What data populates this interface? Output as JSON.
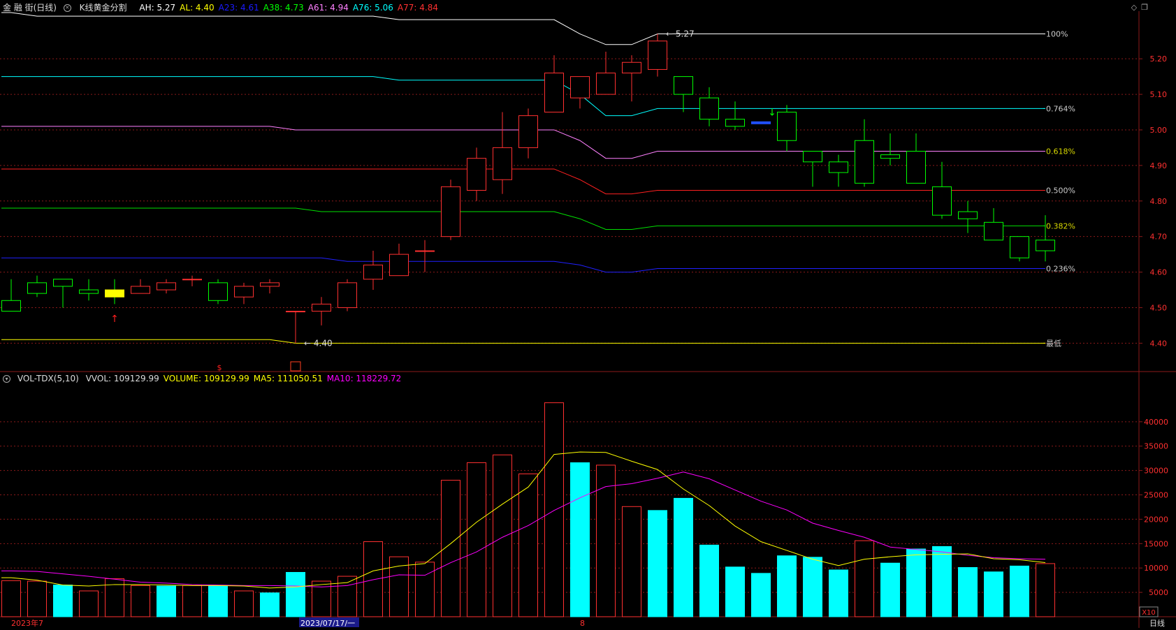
{
  "header": {
    "stock": "金 融 街(日线)",
    "indicator_name": "K线黄金分割",
    "values": [
      {
        "label": "AH: 5.27",
        "color": "#ffffff"
      },
      {
        "label": "AL: 4.40",
        "color": "#ffff00"
      },
      {
        "label": "A23: 4.61",
        "color": "#1a1aff"
      },
      {
        "label": "A38: 4.73",
        "color": "#00ff00"
      },
      {
        "label": "A61: 4.94",
        "color": "#ff80ff"
      },
      {
        "label": "A76: 5.06",
        "color": "#00ffff"
      },
      {
        "label": "A77: 4.84",
        "color": "#ff3030"
      }
    ]
  },
  "vol_header": {
    "name": "VOL-TDX(5,10)",
    "items": [
      {
        "label": "VVOL: 109129.99",
        "color": "#dddddd"
      },
      {
        "label": "VOLUME: 109129.99",
        "color": "#ffff00"
      },
      {
        "label": "MA5: 111050.51",
        "color": "#ffff00"
      },
      {
        "label": "MA10: 118229.72",
        "color": "#ff00ff"
      }
    ]
  },
  "footer": {
    "date_left": "2023年7",
    "date_cursor": "2023/07/17/一",
    "date_mid": "8",
    "period_tab": "日线",
    "scale_tag": "X10"
  },
  "colors": {
    "up": "#ff3030",
    "down": "#00ff00",
    "cyan_bar": "#00ffff",
    "ma5": "#ffff00",
    "ma10": "#ff00ff",
    "grid": "#8b1a1a"
  },
  "chart_data": [
    {
      "type": "candlestick",
      "ylim": [
        4.33,
        5.33
      ],
      "y_ticks": [
        "5.20",
        "5.10",
        "5.00",
        "4.90",
        "4.80",
        "4.70",
        "4.60",
        "4.50",
        "4.40"
      ],
      "candles": [
        {
          "o": 4.52,
          "h": 4.58,
          "l": 4.49,
          "c": 4.49
        },
        {
          "o": 4.57,
          "h": 4.59,
          "l": 4.53,
          "c": 4.54
        },
        {
          "o": 4.58,
          "h": 4.58,
          "l": 4.5,
          "c": 4.56
        },
        {
          "o": 4.55,
          "h": 4.58,
          "l": 4.52,
          "c": 4.54
        },
        {
          "o": 4.55,
          "h": 4.58,
          "l": 4.51,
          "c": 4.53
        },
        {
          "o": 4.54,
          "h": 4.58,
          "l": 4.54,
          "c": 4.56
        },
        {
          "o": 4.55,
          "h": 4.58,
          "l": 4.54,
          "c": 4.57
        },
        {
          "o": 4.58,
          "h": 4.59,
          "l": 4.56,
          "c": 4.58
        },
        {
          "o": 4.57,
          "h": 4.58,
          "l": 4.51,
          "c": 4.52
        },
        {
          "o": 4.53,
          "h": 4.57,
          "l": 4.51,
          "c": 4.56
        },
        {
          "o": 4.56,
          "h": 4.58,
          "l": 4.54,
          "c": 4.57
        },
        {
          "o": 4.49,
          "h": 4.49,
          "l": 4.4,
          "c": 4.49
        },
        {
          "o": 4.49,
          "h": 4.53,
          "l": 4.45,
          "c": 4.51
        },
        {
          "o": 4.5,
          "h": 4.58,
          "l": 4.49,
          "c": 4.57
        },
        {
          "o": 4.58,
          "h": 4.66,
          "l": 4.55,
          "c": 4.62
        },
        {
          "o": 4.59,
          "h": 4.68,
          "l": 4.59,
          "c": 4.65
        },
        {
          "o": 4.66,
          "h": 4.69,
          "l": 4.6,
          "c": 4.66
        },
        {
          "o": 4.7,
          "h": 4.86,
          "l": 4.69,
          "c": 4.84
        },
        {
          "o": 4.83,
          "h": 4.95,
          "l": 4.8,
          "c": 4.92
        },
        {
          "o": 4.86,
          "h": 5.05,
          "l": 4.82,
          "c": 4.95
        },
        {
          "o": 4.95,
          "h": 5.06,
          "l": 4.92,
          "c": 5.04
        },
        {
          "o": 5.05,
          "h": 5.21,
          "l": 5.05,
          "c": 5.16
        },
        {
          "o": 5.09,
          "h": 5.15,
          "l": 5.06,
          "c": 5.15
        },
        {
          "o": 5.1,
          "h": 5.22,
          "l": 5.1,
          "c": 5.16
        },
        {
          "o": 5.16,
          "h": 5.21,
          "l": 5.08,
          "c": 5.19
        },
        {
          "o": 5.17,
          "h": 5.27,
          "l": 5.15,
          "c": 5.25
        },
        {
          "o": 5.15,
          "h": 5.15,
          "l": 5.05,
          "c": 5.1
        },
        {
          "o": 5.09,
          "h": 5.12,
          "l": 5.01,
          "c": 5.03
        },
        {
          "o": 5.03,
          "h": 5.08,
          "l": 5.0,
          "c": 5.01
        },
        {
          "o": 5.02,
          "h": 5.02,
          "l": 5.02,
          "c": 5.02,
          "flat": true
        },
        {
          "o": 5.05,
          "h": 5.07,
          "l": 4.94,
          "c": 4.97
        },
        {
          "o": 4.94,
          "h": 4.94,
          "l": 4.84,
          "c": 4.91
        },
        {
          "o": 4.91,
          "h": 4.93,
          "l": 4.84,
          "c": 4.88
        },
        {
          "o": 4.97,
          "h": 5.03,
          "l": 4.84,
          "c": 4.85
        },
        {
          "o": 4.93,
          "h": 4.99,
          "l": 4.9,
          "c": 4.92
        },
        {
          "o": 4.94,
          "h": 4.99,
          "l": 4.85,
          "c": 4.85
        },
        {
          "o": 4.84,
          "h": 4.91,
          "l": 4.75,
          "c": 4.76
        },
        {
          "o": 4.77,
          "h": 4.8,
          "l": 4.71,
          "c": 4.75
        },
        {
          "o": 4.74,
          "h": 4.78,
          "l": 4.69,
          "c": 4.69
        },
        {
          "o": 4.7,
          "h": 4.7,
          "l": 4.63,
          "c": 4.64
        },
        {
          "o": 4.69,
          "h": 4.76,
          "l": 4.63,
          "c": 4.66
        }
      ],
      "fib_levels": [
        {
          "label": "100%",
          "color": "#ffffff",
          "values": [
            5.33,
            5.32,
            5.32,
            5.32,
            5.32,
            5.32,
            5.32,
            5.32,
            5.32,
            5.32,
            5.32,
            5.32,
            5.32,
            5.32,
            5.32,
            5.31,
            5.31,
            5.31,
            5.31,
            5.31,
            5.31,
            5.31,
            5.27,
            5.24,
            5.24,
            5.27,
            5.27,
            5.27,
            5.27,
            5.27,
            5.27,
            5.27,
            5.27,
            5.27,
            5.27,
            5.27,
            5.27,
            5.27,
            5.27,
            5.27,
            5.27
          ]
        },
        {
          "label": "0.764%",
          "color": "#00ffff",
          "values": [
            5.15,
            5.15,
            5.15,
            5.15,
            5.15,
            5.15,
            5.15,
            5.15,
            5.15,
            5.15,
            5.15,
            5.15,
            5.15,
            5.15,
            5.15,
            5.14,
            5.14,
            5.14,
            5.14,
            5.14,
            5.14,
            5.14,
            5.1,
            5.04,
            5.04,
            5.06,
            5.06,
            5.06,
            5.06,
            5.06,
            5.06,
            5.06,
            5.06,
            5.06,
            5.06,
            5.06,
            5.06,
            5.06,
            5.06,
            5.06,
            5.06
          ]
        },
        {
          "label": "0.618%",
          "color": "#ff80ff",
          "values": [
            5.01,
            5.01,
            5.01,
            5.01,
            5.01,
            5.01,
            5.01,
            5.01,
            5.01,
            5.01,
            5.01,
            5.0,
            5.0,
            5.0,
            5.0,
            5.0,
            5.0,
            5.0,
            5.0,
            5.0,
            5.0,
            5.0,
            4.97,
            4.92,
            4.92,
            4.94,
            4.94,
            4.94,
            4.94,
            4.94,
            4.94,
            4.94,
            4.94,
            4.94,
            4.94,
            4.94,
            4.94,
            4.94,
            4.94,
            4.94,
            4.94
          ]
        },
        {
          "label": "0.500%",
          "color": "#ff2020",
          "values": [
            4.89,
            4.89,
            4.89,
            4.89,
            4.89,
            4.89,
            4.89,
            4.89,
            4.89,
            4.89,
            4.89,
            4.89,
            4.89,
            4.89,
            4.89,
            4.89,
            4.89,
            4.89,
            4.89,
            4.89,
            4.89,
            4.89,
            4.86,
            4.82,
            4.82,
            4.83,
            4.83,
            4.83,
            4.83,
            4.83,
            4.83,
            4.83,
            4.83,
            4.83,
            4.83,
            4.83,
            4.83,
            4.83,
            4.83,
            4.83,
            4.83
          ]
        },
        {
          "label": "0.382%",
          "color": "#00e000",
          "values": [
            4.78,
            4.78,
            4.78,
            4.78,
            4.78,
            4.78,
            4.78,
            4.78,
            4.78,
            4.78,
            4.78,
            4.78,
            4.77,
            4.77,
            4.77,
            4.77,
            4.77,
            4.77,
            4.77,
            4.77,
            4.77,
            4.77,
            4.75,
            4.72,
            4.72,
            4.73,
            4.73,
            4.73,
            4.73,
            4.73,
            4.73,
            4.73,
            4.73,
            4.73,
            4.73,
            4.73,
            4.73,
            4.73,
            4.73,
            4.73,
            4.73
          ]
        },
        {
          "label": "0.236%",
          "color": "#2020ff",
          "values": [
            4.64,
            4.64,
            4.64,
            4.64,
            4.64,
            4.64,
            4.64,
            4.64,
            4.64,
            4.64,
            4.64,
            4.64,
            4.64,
            4.63,
            4.63,
            4.63,
            4.63,
            4.63,
            4.63,
            4.63,
            4.63,
            4.63,
            4.62,
            4.6,
            4.6,
            4.61,
            4.61,
            4.61,
            4.61,
            4.61,
            4.61,
            4.61,
            4.61,
            4.61,
            4.61,
            4.61,
            4.61,
            4.61,
            4.61,
            4.61,
            4.61
          ]
        },
        {
          "label": "最低",
          "color": "#ffff00",
          "values": [
            4.41,
            4.41,
            4.41,
            4.41,
            4.41,
            4.41,
            4.41,
            4.41,
            4.41,
            4.41,
            4.41,
            4.4,
            4.4,
            4.4,
            4.4,
            4.4,
            4.4,
            4.4,
            4.4,
            4.4,
            4.4,
            4.4,
            4.4,
            4.4,
            4.4,
            4.4,
            4.4,
            4.4,
            4.4,
            4.4,
            4.4,
            4.4,
            4.4,
            4.4,
            4.4,
            4.4,
            4.4,
            4.4,
            4.4,
            4.4,
            4.4
          ]
        }
      ],
      "annotations": [
        {
          "text": "5.27",
          "idx": 25,
          "value": 5.27
        },
        {
          "text": "4.40",
          "idx": 11,
          "value": 4.4
        }
      ]
    },
    {
      "type": "bar",
      "ylim": [
        0,
        48000
      ],
      "y_ticks": [
        "40000",
        "35000",
        "30000",
        "25000",
        "20000",
        "15000",
        "10000",
        "5000"
      ],
      "volumes": [
        7400,
        7300,
        6500,
        5300,
        7800,
        6400,
        6300,
        6400,
        6400,
        5300,
        4900,
        9100,
        7300,
        8300,
        15400,
        12300,
        11200,
        28000,
        31600,
        33200,
        29300,
        43900,
        31600,
        31100,
        22600,
        21800,
        24300,
        14700,
        10200,
        8900,
        12500,
        12200,
        9600,
        15600,
        11000,
        13900,
        14400,
        10100,
        9200,
        10400,
        10900
      ],
      "style": [
        "up",
        "up",
        "cyan",
        "up",
        "up",
        "up",
        "cyan",
        "up",
        "cyan",
        "up",
        "cyan",
        "cyan",
        "up",
        "up",
        "up",
        "up",
        "up",
        "up",
        "up",
        "up",
        "up",
        "up",
        "cyan",
        "up",
        "up",
        "cyan",
        "cyan",
        "cyan",
        "cyan",
        "cyan",
        "cyan",
        "cyan",
        "cyan",
        "up",
        "cyan",
        "cyan",
        "cyan",
        "cyan",
        "cyan",
        "cyan",
        "up"
      ],
      "ma5": [
        8000,
        7500,
        6500,
        6300,
        6600,
        6600,
        6500,
        6400,
        6400,
        6300,
        5900,
        6100,
        6600,
        7000,
        9400,
        10400,
        10900,
        15000,
        19400,
        23100,
        26600,
        33300,
        33800,
        33700,
        31900,
        30200,
        26200,
        22800,
        18600,
        15400,
        13600,
        11800,
        10500,
        11800,
        12300,
        12700,
        12800,
        12900,
        11900,
        11700,
        11100
      ],
      "ma10": [
        9400,
        9300,
        8800,
        8300,
        7700,
        7100,
        6900,
        6600,
        6500,
        6400,
        6400,
        6300,
        6100,
        6400,
        7600,
        8600,
        8500,
        11100,
        13300,
        16300,
        18700,
        21800,
        24400,
        26700,
        27300,
        28400,
        29700,
        28300,
        26000,
        23700,
        21900,
        19200,
        17700,
        16300,
        14300,
        13800,
        13300,
        12600,
        12100,
        11900,
        11800
      ]
    }
  ]
}
